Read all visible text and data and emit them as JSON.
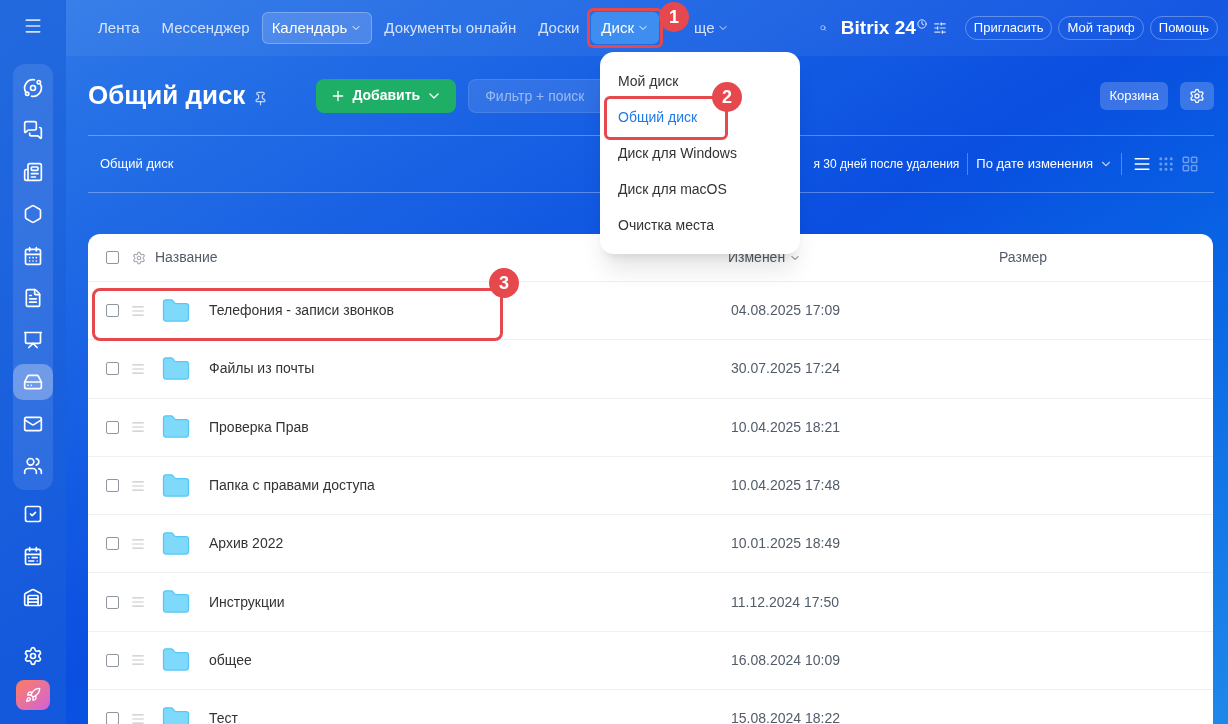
{
  "sidebar": {
    "items": [
      {
        "selected": false
      },
      {
        "selected": false
      },
      {
        "selected": false
      },
      {
        "selected": false
      },
      {
        "selected": false
      },
      {
        "selected": false
      },
      {
        "selected": false
      },
      {
        "selected": true
      },
      {
        "selected": false
      },
      {
        "selected": false
      },
      {
        "selected": false
      },
      {
        "selected": false
      },
      {
        "selected": false
      },
      {
        "selected": false
      },
      {
        "selected": false
      }
    ]
  },
  "top_nav": {
    "items": [
      {
        "label": "Лента",
        "selected": false,
        "expanded": false,
        "has_menu": false
      },
      {
        "label": "Мессенджер",
        "selected": false,
        "expanded": false,
        "has_menu": false
      },
      {
        "label": "Календарь",
        "selected": true,
        "expanded": false,
        "has_menu": true
      },
      {
        "label": "Документы онлайн",
        "selected": false,
        "expanded": false,
        "has_menu": false
      },
      {
        "label": "Доски",
        "selected": false,
        "expanded": false,
        "has_menu": false
      },
      {
        "label": "Диск",
        "selected": false,
        "expanded": true,
        "has_menu": true
      },
      {
        "label": "ще",
        "selected": false,
        "expanded": false,
        "has_menu": true
      }
    ],
    "logo": {
      "name": "Bitrix",
      "number": "24"
    },
    "buttons": [
      "Пригласить",
      "Мой тариф",
      "Помощь"
    ]
  },
  "page": {
    "title": "Общий диск",
    "add_button": "Добавить",
    "search": {
      "placeholder": "Фильтр + поиск"
    },
    "trash_button": "Корзина"
  },
  "toolbar": {
    "breadcrumb": "Общий диск",
    "notice": "я 30 дней после удаления",
    "sort": "По дате изменения",
    "views": [
      {
        "selected": true
      },
      {
        "selected": false
      },
      {
        "selected": false
      }
    ]
  },
  "disk_menu": {
    "items": [
      {
        "label": "Мой диск",
        "selected": false
      },
      {
        "label": "Общий диск",
        "selected": true
      },
      {
        "label": "Диск для Windows",
        "selected": false
      },
      {
        "label": "Диск для macOS",
        "selected": false
      },
      {
        "label": "Очистка места",
        "selected": false
      }
    ]
  },
  "table": {
    "all_checked": false,
    "columns": [
      "Название",
      "Изменен",
      "Размер"
    ],
    "rows": [
      {
        "name": "Телефония - записи звонков",
        "modified": "04.08.2025 17:09",
        "checked": false
      },
      {
        "name": "Файлы из почты",
        "modified": "30.07.2025 17:24",
        "checked": false
      },
      {
        "name": "Проверка Прав",
        "modified": "10.04.2025 18:21",
        "checked": false
      },
      {
        "name": "Папка с правами доступа",
        "modified": "10.04.2025 17:48",
        "checked": false
      },
      {
        "name": "Архив 2022",
        "modified": "10.01.2025 18:49",
        "checked": false
      },
      {
        "name": "Инструкции",
        "modified": "11.12.2024 17:50",
        "checked": false
      },
      {
        "name": "общее",
        "modified": "16.08.2024 10:09",
        "checked": false
      },
      {
        "name": "Тест",
        "modified": "15.08.2024 18:22",
        "checked": false
      }
    ]
  },
  "annotations": [
    "1",
    "2",
    "3"
  ]
}
